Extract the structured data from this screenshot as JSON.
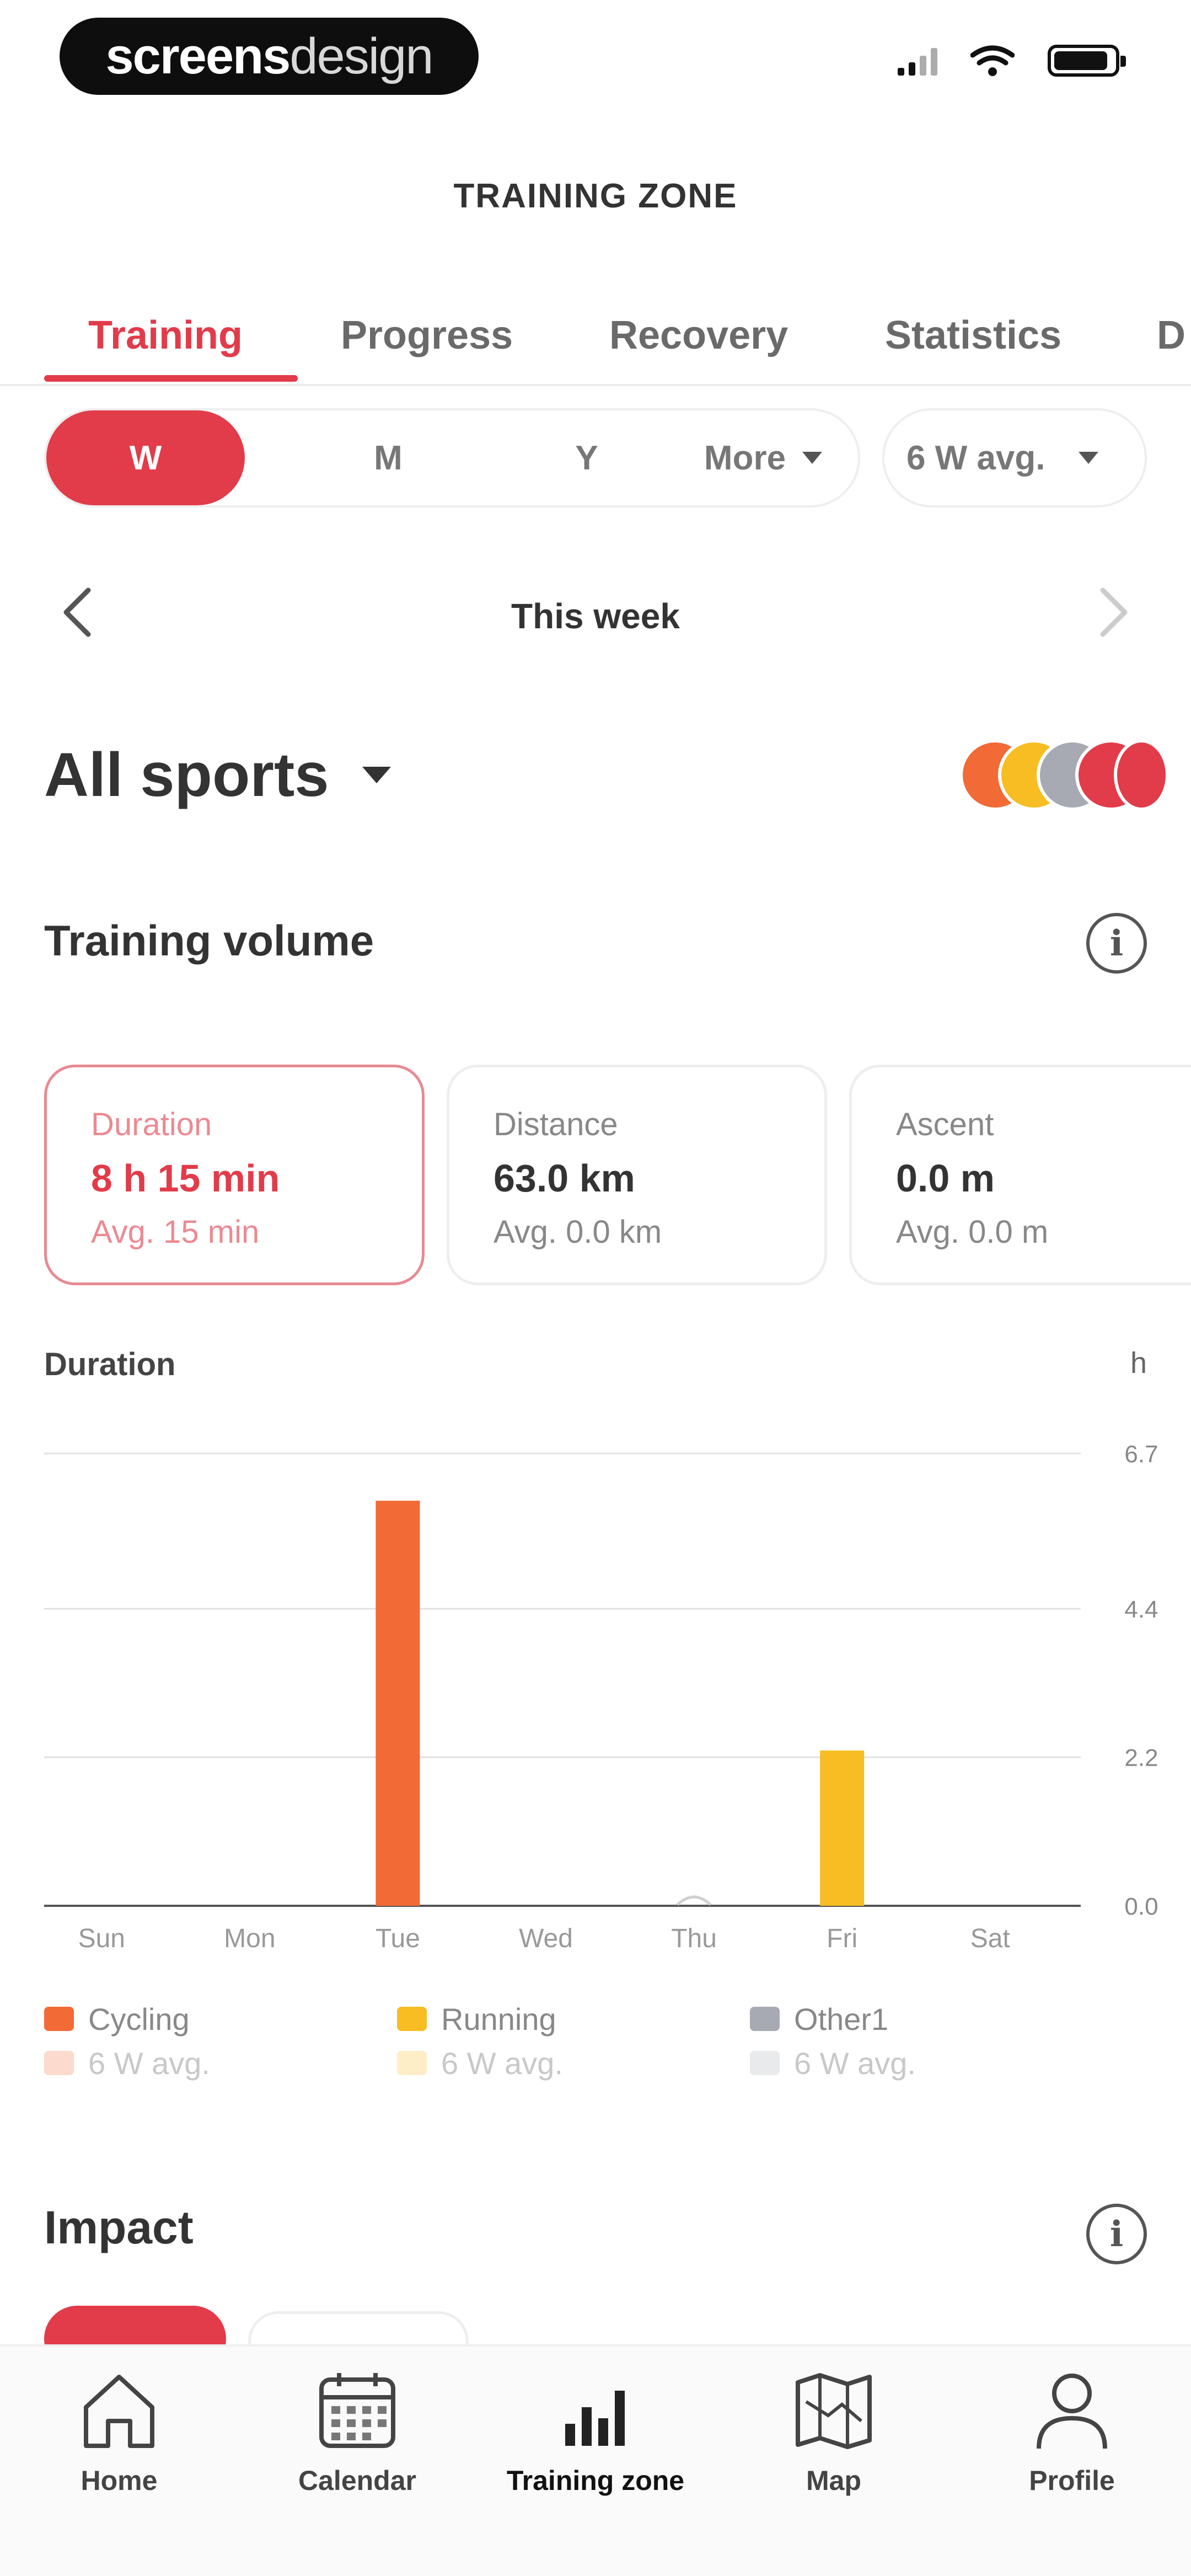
{
  "status": {
    "brand_bold": "screens",
    "brand_light": "design"
  },
  "header": {
    "title": "TRAINING ZONE"
  },
  "tabs": [
    {
      "label": "Training",
      "active": true
    },
    {
      "label": "Progress",
      "active": false
    },
    {
      "label": "Recovery",
      "active": false
    },
    {
      "label": "Statistics",
      "active": false
    },
    {
      "label": "D",
      "active": false
    }
  ],
  "period": {
    "options": [
      "W",
      "M",
      "Y",
      "More"
    ],
    "selected": "W",
    "average_select": "6 W avg."
  },
  "week_nav": {
    "label": "This week"
  },
  "sport": {
    "title": "All sports"
  },
  "training_volume": {
    "title": "Training volume",
    "cards": [
      {
        "label": "Duration",
        "value": "8 h 15 min",
        "avg": "Avg. 15 min",
        "active": true
      },
      {
        "label": "Distance",
        "value": "63.0 km",
        "avg": "Avg. 0.0 km",
        "active": false
      },
      {
        "label": "Ascent",
        "value": "0.0 m",
        "avg": "Avg. 0.0 m",
        "active": false
      }
    ]
  },
  "chart_data": {
    "type": "bar",
    "title": "Duration",
    "ylabel": "h",
    "categories": [
      "Sun",
      "Mon",
      "Tue",
      "Wed",
      "Thu",
      "Fri",
      "Sat"
    ],
    "yticks": [
      "0.0",
      "2.2",
      "4.4",
      "6.7"
    ],
    "ylim": [
      0,
      6.7
    ],
    "grid": true,
    "series": [
      {
        "name": "Cycling",
        "color": "#f26a36",
        "values": [
          0,
          0,
          6.0,
          0,
          0,
          0,
          0
        ]
      },
      {
        "name": "Running",
        "color": "#f7bd22",
        "values": [
          0,
          0,
          0,
          0,
          0,
          2.3,
          0
        ]
      },
      {
        "name": "Other1",
        "color": "#a7aab3",
        "values": [
          0,
          0,
          0,
          0,
          0.05,
          0,
          0
        ]
      }
    ],
    "legend": [
      {
        "name": "Cycling",
        "color": "#f26a36",
        "avg_label": "6 W avg."
      },
      {
        "name": "Running",
        "color": "#f7bd22",
        "avg_label": "6 W avg."
      },
      {
        "name": "Other1",
        "color": "#a7aab3",
        "avg_label": "6 W avg."
      }
    ],
    "legend_placement": "bottom"
  },
  "impact": {
    "title": "Impact"
  },
  "bottom_nav": [
    {
      "label": "Home",
      "icon": "home-icon"
    },
    {
      "label": "Calendar",
      "icon": "calendar-icon"
    },
    {
      "label": "Training zone",
      "icon": "bar-chart-icon",
      "active": true
    },
    {
      "label": "Map",
      "icon": "map-icon"
    },
    {
      "label": "Profile",
      "icon": "profile-icon"
    }
  ],
  "colors": {
    "accent": "#e23b4a",
    "cycling": "#f26a36",
    "running": "#f7bd22",
    "other": "#a7aab3"
  }
}
